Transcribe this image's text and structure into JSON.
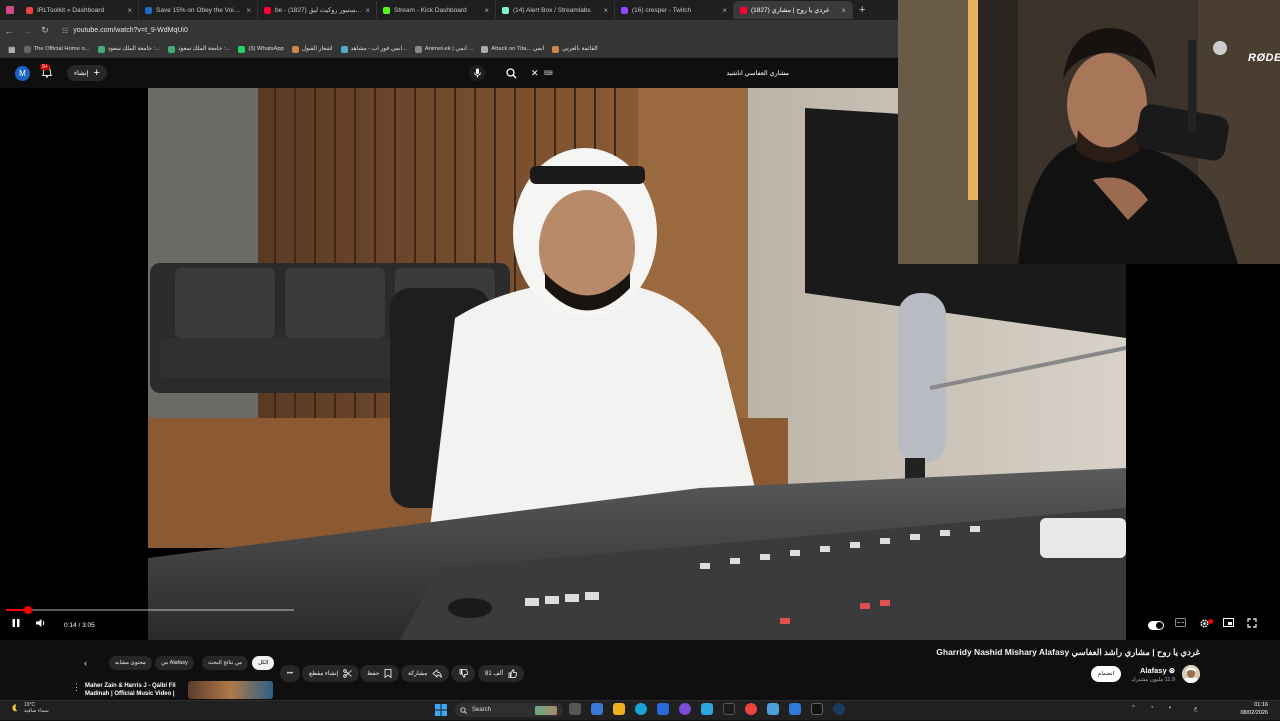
{
  "browser": {
    "tabs": [
      {
        "title": "IRLToolkit » Dashboard",
        "fav": "#e8453c",
        "active": false
      },
      {
        "title": "Save 15% on Obey the Voice™",
        "fav": "#1b6ac9",
        "active": false
      },
      {
        "title": "be - كريستيور روكيت ليق (1827)",
        "fav": "#ff0033",
        "active": false
      },
      {
        "title": "Stream - Kick Dashboard",
        "fav": "#53fc18",
        "active": false
      },
      {
        "title": "(14) Alert Box / Streamlabs",
        "fav": "#80f5d2",
        "active": false
      },
      {
        "title": "(16) cresper - Twitch",
        "fav": "#9146ff",
        "active": false
      },
      {
        "title": "(1827) غردي يا روح | مشاري",
        "fav": "#ff0033",
        "active": true
      }
    ],
    "new_tab": "+",
    "url": "youtube.com/watch?v=t_9-WdMqUi0",
    "bookmarks": [
      "The Official Home o...",
      "جامعة الملك سعود :...",
      "جامعة الملك سعود :...",
      "(3) WhatsApp",
      "اشعار القبول",
      "انمي فور اب - مشاهد...",
      "AnimeLek | انمي ...",
      "Attack on Tita... انمي",
      "القائمة بالعربي"
    ]
  },
  "youtube": {
    "avatar_letter": "M",
    "notif_count": "9+",
    "create_label": "إنشاء",
    "search_text": "مشاري العفاسي اناشيد",
    "search_kbd": "⌨"
  },
  "player": {
    "progress": 0.076,
    "buffered": 0.23,
    "time": "0:14 / 3:05"
  },
  "webcam": {
    "brand": "RØDE"
  },
  "video": {
    "title": "Gharridy Nashid Mishary Alafasy غردي يا روح | مشاري راشد العفاسي",
    "channel": "Alafasy ⊛",
    "subscribers": "11.9 مليون مشترك",
    "join_label": "انضمام",
    "likes": "81 ألف",
    "share_label": "مشاركة",
    "save_label": "حفظ",
    "clip_label": "إنشاء مقطع",
    "more_label": "•••",
    "chips": [
      "الكل",
      "من نتائج البحث",
      "من Alafasy",
      "محتوى مشابه"
    ],
    "rec_title": "Maher Zain & Harris J - Qalbi Fil Madinah | Official Music Video |"
  },
  "taskbar": {
    "temp": "19°C",
    "weather": "سماء صافية",
    "search_placeholder": "Search",
    "time": "01:16",
    "date": "08/02/2026",
    "lang": "ع"
  }
}
